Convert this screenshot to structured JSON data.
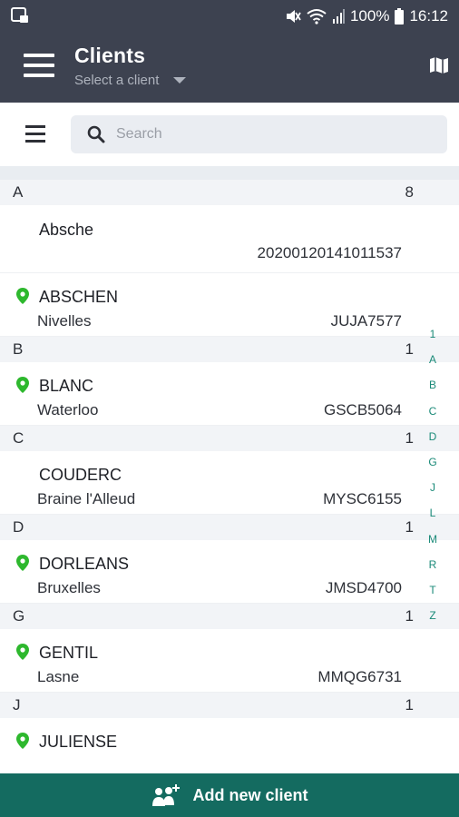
{
  "status_bar": {
    "battery": "100%",
    "time": "16:12"
  },
  "header": {
    "title": "Clients",
    "subtitle": "Select a client"
  },
  "search": {
    "placeholder": "Search"
  },
  "sections": [
    {
      "letter": "A",
      "count": "8",
      "clients": [
        {
          "name": "Absche",
          "city": "",
          "code": "20200120141011537",
          "located": false
        },
        {
          "name": "ABSCHEN",
          "city": "Nivelles",
          "code": "JUJA7577",
          "located": true
        }
      ]
    },
    {
      "letter": "B",
      "count": "1",
      "clients": [
        {
          "name": "BLANC",
          "city": "Waterloo",
          "code": "GSCB5064",
          "located": true
        }
      ]
    },
    {
      "letter": "C",
      "count": "1",
      "clients": [
        {
          "name": "COUDERC",
          "city": "Braine l'Alleud",
          "code": "MYSC6155",
          "located": false
        }
      ]
    },
    {
      "letter": "D",
      "count": "1",
      "clients": [
        {
          "name": "DORLEANS",
          "city": "Bruxelles",
          "code": "JMSD4700",
          "located": true
        }
      ]
    },
    {
      "letter": "G",
      "count": "1",
      "clients": [
        {
          "name": "GENTIL",
          "city": "Lasne",
          "code": "MMQG6731",
          "located": true
        }
      ]
    },
    {
      "letter": "J",
      "count": "1",
      "clients": [
        {
          "name": "JULIENSE",
          "city": "",
          "code": "",
          "located": true
        }
      ]
    }
  ],
  "alpha_index": [
    "1",
    "A",
    "B",
    "C",
    "D",
    "G",
    "J",
    "L",
    "M",
    "R",
    "T",
    "Z"
  ],
  "add_button": {
    "label": "Add new client"
  },
  "colors": {
    "header_bg": "#3d4250",
    "pin": "#2eb82e",
    "accent": "#146b60",
    "index_text": "#1a8a78"
  }
}
